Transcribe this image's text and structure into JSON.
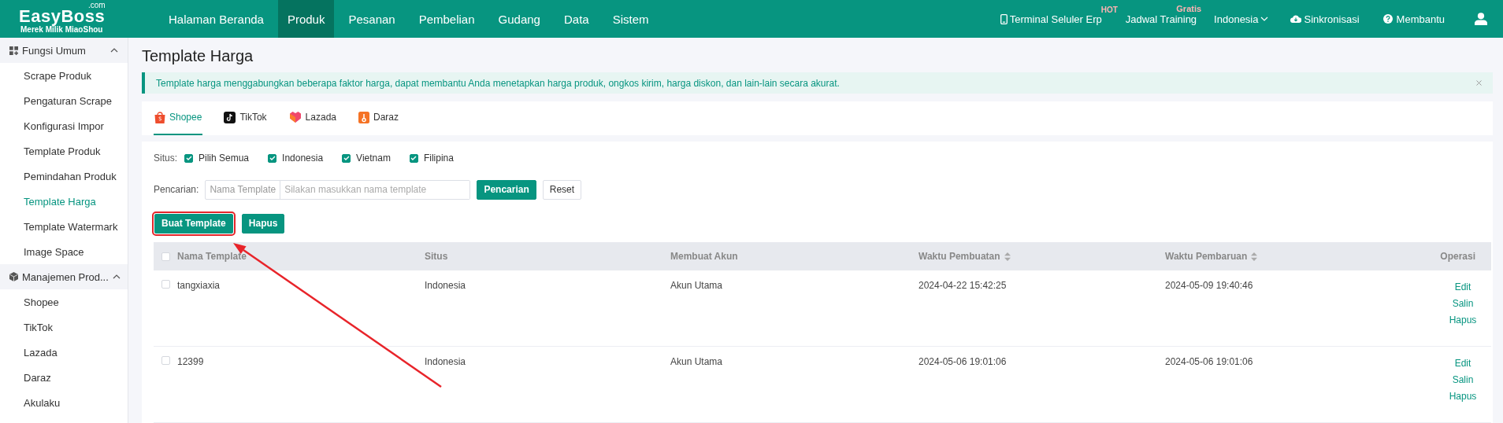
{
  "logo": {
    "name": "EasyBoss",
    "suffix": ".com",
    "tagline": "Merek Milik MiaoShou"
  },
  "nav": [
    {
      "label": "Halaman Beranda",
      "selected": false
    },
    {
      "label": "Produk",
      "selected": true
    },
    {
      "label": "Pesanan",
      "selected": false
    },
    {
      "label": "Pembelian",
      "selected": false
    },
    {
      "label": "Gudang",
      "selected": false
    },
    {
      "label": "Data",
      "selected": false
    },
    {
      "label": "Sistem",
      "selected": false
    }
  ],
  "top_right": {
    "mobile": {
      "label": "Terminal Seluler Erp",
      "badge": "HOT"
    },
    "training": {
      "label": "Jadwal Training",
      "badge": "Gratis"
    },
    "language": "Indonesia",
    "sync": "Sinkronisasi",
    "help": "Membantu"
  },
  "sidebar": {
    "groups": [
      {
        "title": "Fungsi Umum",
        "expanded": true,
        "items": [
          {
            "label": "Scrape Produk",
            "selected": false
          },
          {
            "label": "Pengaturan Scrape",
            "selected": false
          },
          {
            "label": "Konfigurasi Impor",
            "selected": false
          },
          {
            "label": "Template Produk",
            "selected": false
          },
          {
            "label": "Pemindahan Produk",
            "selected": false
          },
          {
            "label": "Template Harga",
            "selected": true
          },
          {
            "label": "Template Watermark",
            "selected": false
          },
          {
            "label": "Image Space",
            "selected": false
          }
        ]
      },
      {
        "title": "Manajemen Prod...",
        "expanded": true,
        "items": [
          {
            "label": "Shopee",
            "selected": false
          },
          {
            "label": "TikTok",
            "selected": false
          },
          {
            "label": "Lazada",
            "selected": false
          },
          {
            "label": "Daraz",
            "selected": false
          },
          {
            "label": "Akulaku",
            "selected": false
          }
        ]
      }
    ]
  },
  "page": {
    "title": "Template Harga",
    "notice": "Template harga menggabungkan beberapa faktor harga, dapat membantu Anda menetapkan harga produk, ongkos kirim, harga diskon, dan lain-lain secara akurat."
  },
  "platform_tabs": [
    {
      "label": "Shopee",
      "selected": true
    },
    {
      "label": "TikTok",
      "selected": false
    },
    {
      "label": "Lazada",
      "selected": false
    },
    {
      "label": "Daraz",
      "selected": false
    }
  ],
  "filters": {
    "site_label": "Situs:",
    "sites": [
      {
        "label": "Pilih Semua",
        "checked": true
      },
      {
        "label": "Indonesia",
        "checked": true
      },
      {
        "label": "Vietnam",
        "checked": true
      },
      {
        "label": "Filipina",
        "checked": true
      }
    ],
    "search_label": "Pencarian:",
    "search_field": "Nama Template",
    "search_placeholder": "Silakan masukkan nama template",
    "search_button": "Pencarian",
    "reset_button": "Reset"
  },
  "actions": [
    {
      "label": "Buat Template",
      "highlighted": true
    },
    {
      "label": "Hapus",
      "highlighted": false
    }
  ],
  "table": {
    "all_checked": false,
    "columns": [
      {
        "label": "Nama Template",
        "sortable": false
      },
      {
        "label": "Situs",
        "sortable": false
      },
      {
        "label": "Membuat Akun",
        "sortable": false
      },
      {
        "label": "Waktu Pembuatan",
        "sortable": true
      },
      {
        "label": "Waktu Pembaruan",
        "sortable": true
      },
      {
        "label": "Operasi",
        "sortable": false
      }
    ],
    "rows": [
      {
        "checked": false,
        "cells": [
          "tangxiaxia",
          "Indonesia",
          "Akun Utama",
          "2024-04-22 15:42:25",
          "2024-05-09 19:40:46"
        ],
        "operations": [
          "Edit",
          "Salin",
          "Hapus"
        ]
      },
      {
        "checked": false,
        "cells": [
          "12399",
          "Indonesia",
          "Akun Utama",
          "2024-05-06 19:01:06",
          "2024-05-06 19:01:06"
        ],
        "operations": [
          "Edit",
          "Salin",
          "Hapus"
        ]
      }
    ]
  },
  "annotation": {
    "kind": "arrow"
  }
}
